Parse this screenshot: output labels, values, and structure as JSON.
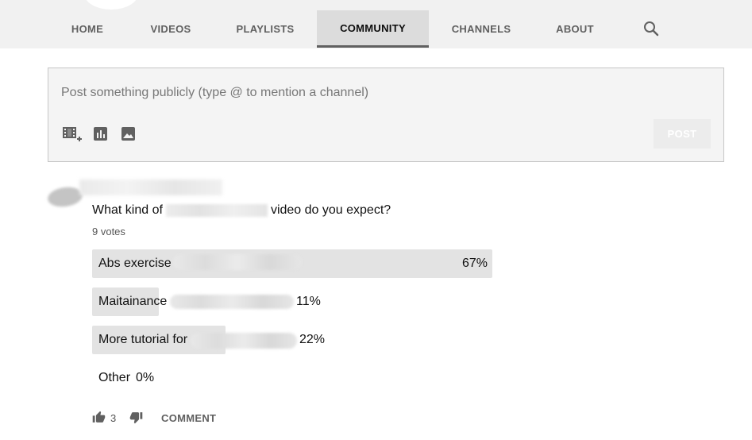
{
  "nav": {
    "tabs": [
      {
        "label": "HOME"
      },
      {
        "label": "VIDEOS"
      },
      {
        "label": "PLAYLISTS"
      },
      {
        "label": "COMMUNITY"
      },
      {
        "label": "CHANNELS"
      },
      {
        "label": "ABOUT"
      }
    ],
    "active_tab": "COMMUNITY",
    "search_icon": "search-icon"
  },
  "composer": {
    "placeholder": "Post something publicly (type @ to mention a channel)",
    "tools": [
      "add-video-icon",
      "poll-icon",
      "image-icon"
    ],
    "post_label": "POST"
  },
  "post": {
    "question_prefix": "What kind of",
    "question_suffix": "video do you expect?",
    "votes": "9 votes",
    "options": [
      {
        "label": "Abs exercise",
        "percent_text": "67%",
        "share": 0.67
      },
      {
        "label": "Maitainance",
        "percent_text": "11%",
        "share": 0.11
      },
      {
        "label": "More tutorial for",
        "percent_text": "22%",
        "share": 0.22
      },
      {
        "label": "Other",
        "percent_text": "0%",
        "share": 0
      }
    ],
    "likes": "3",
    "comment_label": "COMMENT"
  },
  "colors": {
    "nav_bg": "#f1f1f1",
    "active_tab_bg": "#dcdcdc",
    "poll_fill": "#e3e3e3"
  }
}
